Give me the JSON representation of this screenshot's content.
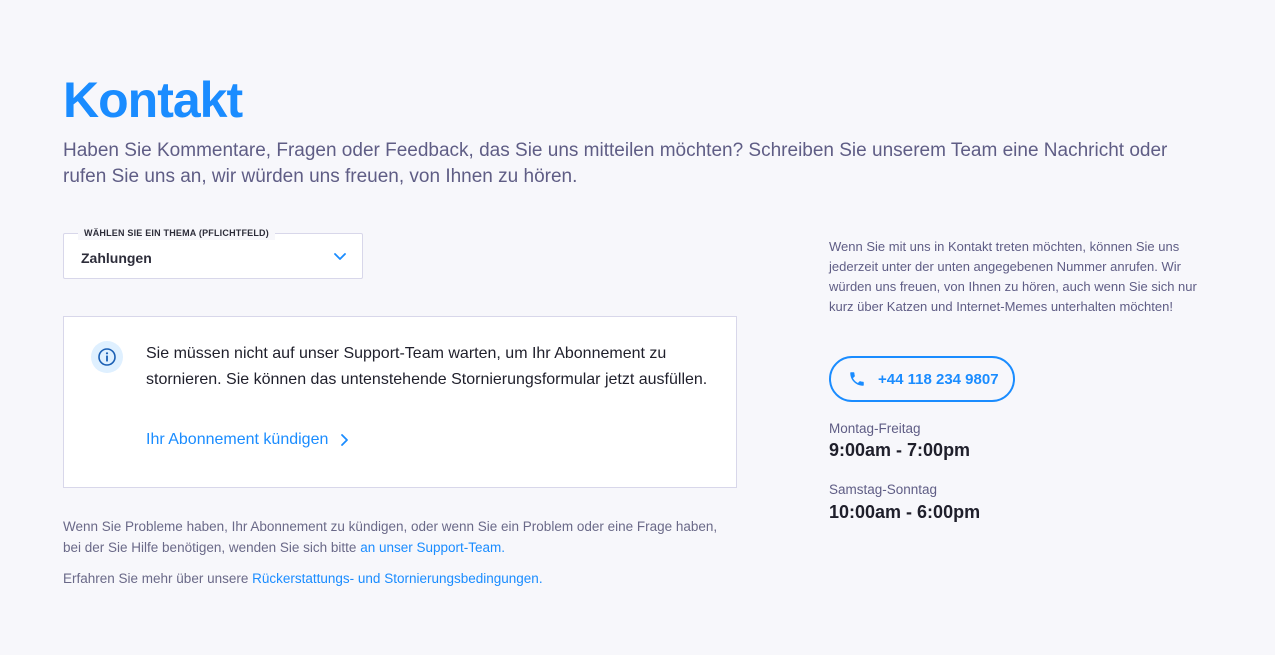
{
  "header": {
    "title": "Kontakt",
    "intro": "Haben Sie Kommentare, Fragen oder Feedback, das Sie uns mitteilen möchten? Schreiben Sie unserem Team eine Nachricht oder rufen Sie uns an, wir würden uns freuen, von Ihnen zu hören."
  },
  "topic_select": {
    "label": "WÄHLEN SIE EIN THEMA (PFLICHTFELD)",
    "value": "Zahlungen",
    "icon": "chevron-down-icon"
  },
  "info_card": {
    "icon": "info-icon",
    "text": "Sie müssen nicht auf unser Support-Team warten, um Ihr Abonnement zu stornieren. Sie können das untenstehende Stornierungsformular jetzt ausfüllen.",
    "link_label": "Ihr Abonnement kündigen",
    "link_icon": "chevron-right-icon"
  },
  "footer": {
    "problems_text": "Wenn Sie Probleme haben, Ihr Abonnement zu kündigen, oder wenn Sie ein Problem oder eine Frage haben, bei der Sie Hilfe benötigen, wenden Sie sich bitte",
    "support_link": "an unser Support-Team.",
    "policy_text": "Erfahren Sie mehr über unsere",
    "policy_link": "Rückerstattungs- und Stornierungsbedingungen."
  },
  "contact": {
    "text": "Wenn Sie mit uns in Kontakt treten möchten, können Sie uns jederzeit unter der unten angegebenen Nummer anrufen. Wir würden uns freuen, von Ihnen zu hören, auch wenn Sie sich nur kurz über Katzen und Internet-Memes unterhalten möchten!",
    "phone": "+44 118 234 9807",
    "phone_icon": "phone-icon",
    "hours": [
      {
        "days": "Montag-Freitag",
        "time": "9:00am - 7:00pm"
      },
      {
        "days": "Samstag-Sonntag",
        "time": "10:00am - 6:00pm"
      }
    ]
  },
  "colors": {
    "accent": "#1a8cff",
    "background": "#f7f7fb",
    "muted_text": "#5f5d85"
  }
}
